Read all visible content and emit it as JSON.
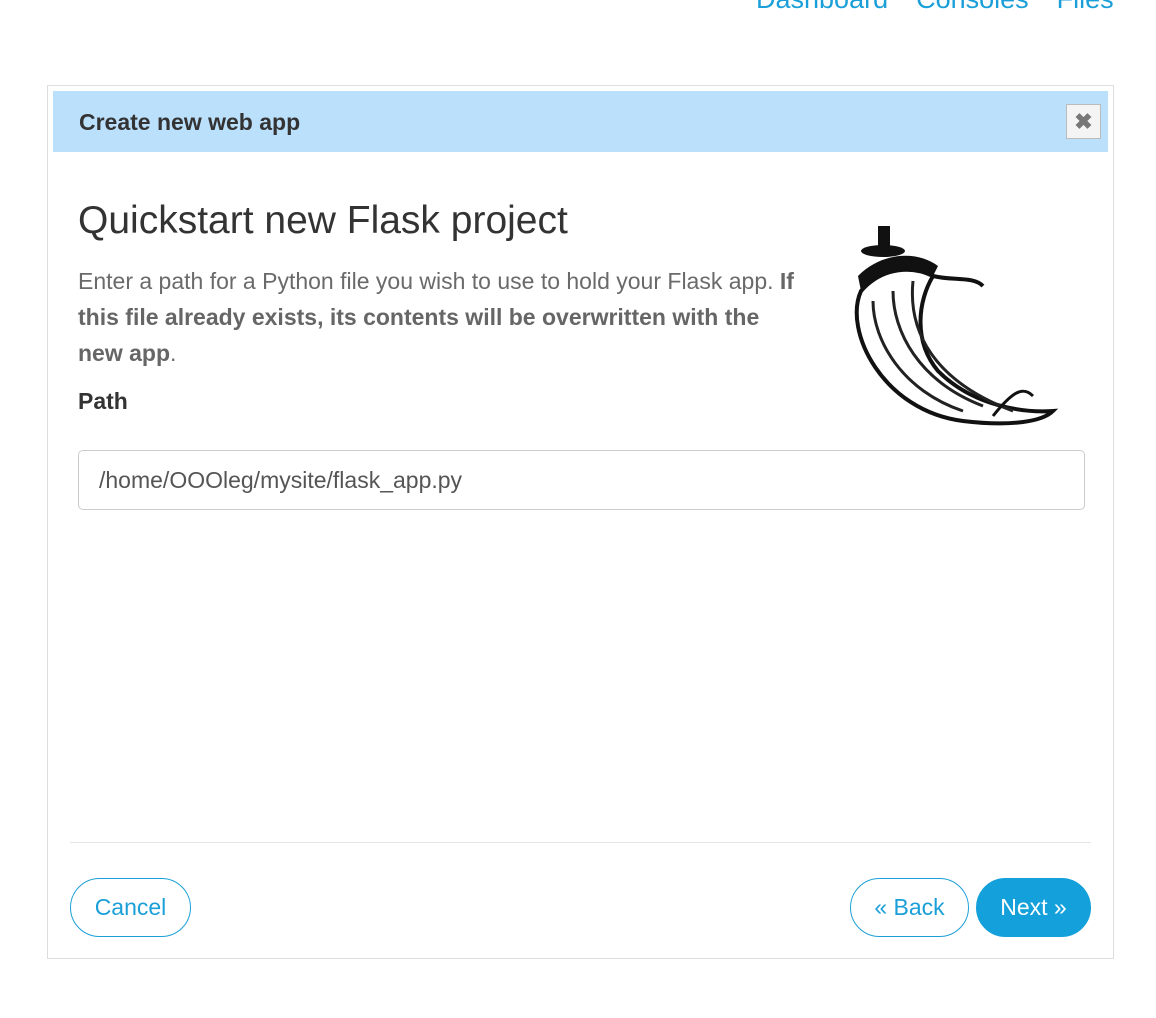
{
  "nav": {
    "items": [
      "Dashboard",
      "Consoles",
      "Files"
    ]
  },
  "modal": {
    "title": "Create new web app",
    "heading": "Quickstart new Flask project",
    "desc_plain": "Enter a path for a Python file you wish to use to hold your Flask app. ",
    "desc_bold": "If this file already exists, its contents will be overwritten with the new app",
    "desc_end": ".",
    "path_label": "Path",
    "path_value": "/home/OOOleg/mysite/flask_app.py",
    "cancel": "Cancel",
    "back": "« Back",
    "next": "Next »"
  }
}
